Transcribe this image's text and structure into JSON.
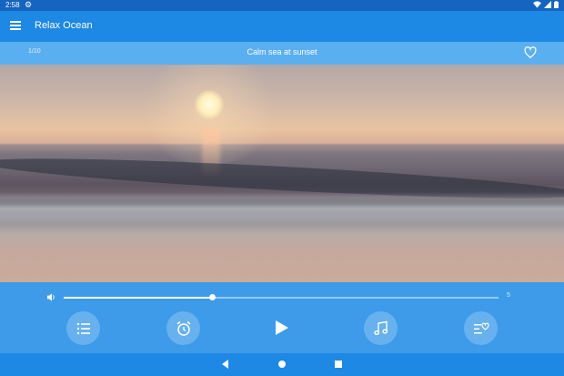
{
  "status_bar": {
    "time": "2:58",
    "icons": [
      "gear-icon",
      "wifi-icon",
      "signal-icon",
      "battery-icon"
    ]
  },
  "app_bar": {
    "title": "Relax Ocean",
    "menu_icon": "hamburger-menu-icon"
  },
  "track": {
    "counter": "1/10",
    "name": "Calm sea at sunset",
    "favorite_icon": "heart-outline-icon"
  },
  "player": {
    "volume_icon": "volume-icon",
    "volume_level_fraction": 0.34,
    "volume_max_label": "5",
    "buttons": [
      {
        "name": "playlist-button",
        "icon": "list-icon"
      },
      {
        "name": "timer-button",
        "icon": "alarm-clock-icon"
      },
      {
        "name": "play-button",
        "icon": "play-icon"
      },
      {
        "name": "music-button",
        "icon": "music-note-icon"
      },
      {
        "name": "favorites-list-button",
        "icon": "heart-list-icon"
      }
    ]
  },
  "nav_bar": {
    "buttons": [
      "back-icon",
      "home-icon",
      "recents-icon"
    ]
  },
  "colors": {
    "primary": "#1e88e5",
    "status_bar": "#1565c0",
    "track_bar": "#5aaff0",
    "controls_bg": "#3d9be9"
  }
}
